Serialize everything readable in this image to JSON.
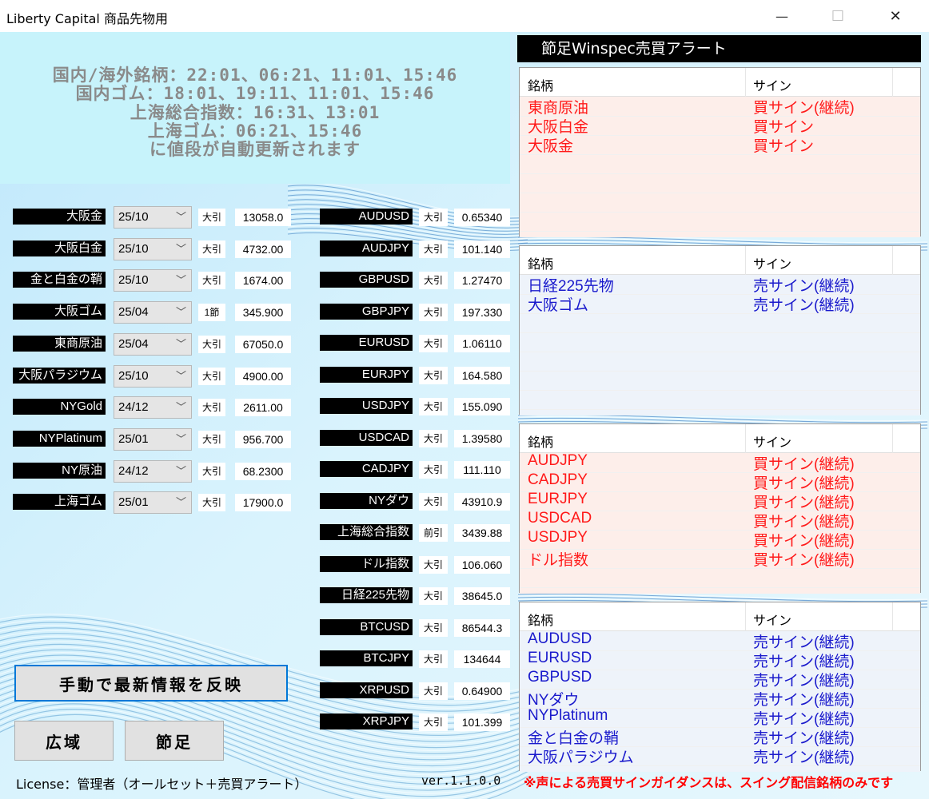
{
  "window": {
    "title": "Liberty Capital 商品先物用",
    "min_glyph": "—",
    "max_glyph": "☐",
    "close_glyph": "✕"
  },
  "info": {
    "lines": [
      "国内/海外銘柄：22:01、06:21、11:01、15:46",
      "国内ゴム：18:01、19:11、11:01、15:46",
      "上海総合指数：16:31、13:01",
      "上海ゴム：06:21、15:46",
      "に値段が自動更新されます"
    ]
  },
  "domestic": [
    {
      "name": "大阪金",
      "month": "25/10",
      "type": "大引",
      "value": "13058.0"
    },
    {
      "name": "大阪白金",
      "month": "25/10",
      "type": "大引",
      "value": "4732.00"
    },
    {
      "name": "金と白金の鞘",
      "month": "25/10",
      "type": "大引",
      "value": "1674.00"
    },
    {
      "name": "大阪ゴム",
      "month": "25/04",
      "type": "1節",
      "value": "345.900"
    },
    {
      "name": "東商原油",
      "month": "25/04",
      "type": "大引",
      "value": "67050.0"
    },
    {
      "name": "大阪パラジウム",
      "month": "25/10",
      "type": "大引",
      "value": "4900.00"
    },
    {
      "name": "NYGold",
      "month": "24/12",
      "type": "大引",
      "value": "2611.00"
    },
    {
      "name": "NYPlatinum",
      "month": "25/01",
      "type": "大引",
      "value": "956.700"
    },
    {
      "name": "NY原油",
      "month": "24/12",
      "type": "大引",
      "value": "68.2300"
    },
    {
      "name": "上海ゴム",
      "month": "25/01",
      "type": "大引",
      "value": "17900.0"
    }
  ],
  "overseas": [
    {
      "name": "AUDUSD",
      "type": "大引",
      "value": "0.65340"
    },
    {
      "name": "AUDJPY",
      "type": "大引",
      "value": "101.140"
    },
    {
      "name": "GBPUSD",
      "type": "大引",
      "value": "1.27470"
    },
    {
      "name": "GBPJPY",
      "type": "大引",
      "value": "197.330"
    },
    {
      "name": "EURUSD",
      "type": "大引",
      "value": "1.06110"
    },
    {
      "name": "EURJPY",
      "type": "大引",
      "value": "164.580"
    },
    {
      "name": "USDJPY",
      "type": "大引",
      "value": "155.090"
    },
    {
      "name": "USDCAD",
      "type": "大引",
      "value": "1.39580"
    },
    {
      "name": "CADJPY",
      "type": "大引",
      "value": "111.110"
    },
    {
      "name": "NYダウ",
      "type": "大引",
      "value": "43910.9"
    },
    {
      "name": "上海総合指数",
      "type": "前引",
      "value": "3439.88"
    },
    {
      "name": "ドル指数",
      "type": "大引",
      "value": "106.060"
    },
    {
      "name": "日経225先物",
      "type": "大引",
      "value": "38645.0"
    },
    {
      "name": "BTCUSD",
      "type": "大引",
      "value": "86544.3"
    },
    {
      "name": "BTCJPY",
      "type": "大引",
      "value": "134644"
    },
    {
      "name": "XRPUSD",
      "type": "大引",
      "value": "0.64900"
    },
    {
      "name": "XRPJPY",
      "type": "大引",
      "value": "101.399"
    }
  ],
  "buttons": {
    "manual": "手動で最新情報を反映",
    "wide": "広域",
    "setsu": "節足"
  },
  "footer": {
    "license": "License：管理者（オールセット＋売買アラート）",
    "version": "ver.1.1.0.0",
    "notice": "※声による売買サインガイダンスは、スイング配信銘柄のみです"
  },
  "alerts": {
    "header": "節足Winspec売買アラート",
    "col_name": "銘柄",
    "col_sign": "サイン",
    "tables": [
      {
        "kind": "buy",
        "rows": [
          {
            "name": "東商原油",
            "sign": "買サイン(継続)"
          },
          {
            "name": "大阪白金",
            "sign": "買サイン"
          },
          {
            "name": "大阪金",
            "sign": "買サイン"
          }
        ]
      },
      {
        "kind": "sell",
        "rows": [
          {
            "name": "日経225先物",
            "sign": "売サイン(継続)"
          },
          {
            "name": "大阪ゴム",
            "sign": "売サイン(継続)"
          }
        ]
      },
      {
        "kind": "buy",
        "rows": [
          {
            "name": "AUDJPY",
            "sign": "買サイン(継続)"
          },
          {
            "name": "CADJPY",
            "sign": "買サイン(継続)"
          },
          {
            "name": "EURJPY",
            "sign": "買サイン(継続)"
          },
          {
            "name": "USDCAD",
            "sign": "買サイン(継続)"
          },
          {
            "name": "USDJPY",
            "sign": "買サイン(継続)"
          },
          {
            "name": "ドル指数",
            "sign": "買サイン(継続)"
          }
        ]
      },
      {
        "kind": "sell",
        "rows": [
          {
            "name": "AUDUSD",
            "sign": "売サイン(継続)"
          },
          {
            "name": "EURUSD",
            "sign": "売サイン(継続)"
          },
          {
            "name": "GBPUSD",
            "sign": "売サイン(継続)"
          },
          {
            "name": "NYダウ",
            "sign": "売サイン(継続)"
          },
          {
            "name": "NYPlatinum",
            "sign": "売サイン(継続)"
          },
          {
            "name": "金と白金の鞘",
            "sign": "売サイン(継続)"
          },
          {
            "name": "大阪パラジウム",
            "sign": "売サイン(継続)"
          }
        ]
      }
    ]
  },
  "colors": {
    "buy_text": "#ff1a1a",
    "sell_text": "#1a1acc",
    "buy_row_bg": "#fdeeea",
    "sell_row_bg": "#eef3fa",
    "label_bg": "#000000"
  },
  "icons": {
    "dropdown": "chevron-down-icon",
    "minimize": "minimize-icon",
    "maximize": "maximize-icon",
    "close": "close-icon"
  }
}
